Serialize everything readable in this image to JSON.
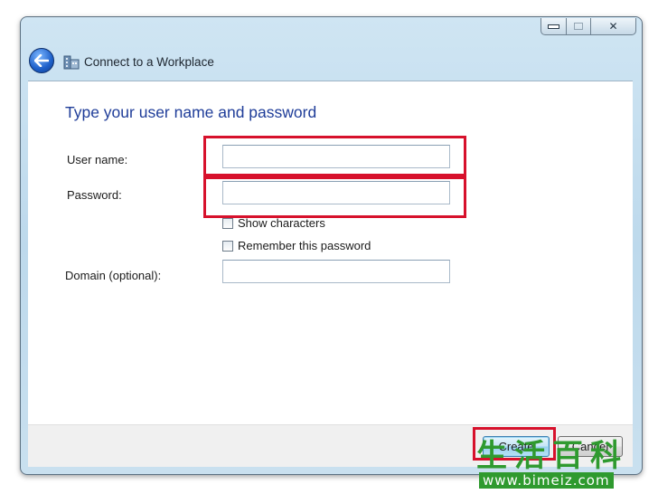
{
  "window": {
    "title": "Connect to a Workplace",
    "caption_buttons": {
      "minimize_icon": "minimize-icon",
      "maximize_icon": "maximize-icon",
      "close_icon": "close-icon",
      "close_glyph": "✕"
    },
    "back_icon": "back-arrow-icon",
    "title_icon": "workplace-network-icon"
  },
  "form": {
    "heading": "Type your user name and password",
    "username": {
      "label": "User name:",
      "value": "",
      "placeholder": ""
    },
    "password": {
      "label": "Password:",
      "value": "",
      "placeholder": ""
    },
    "show_characters": {
      "label": "Show characters",
      "checked": false
    },
    "remember_password": {
      "label": "Remember this password",
      "checked": false
    },
    "domain": {
      "label": "Domain (optional):",
      "value": "",
      "placeholder": ""
    }
  },
  "footer": {
    "create_label": "Create",
    "cancel_label": "Cancel"
  },
  "watermark": {
    "glyphs": [
      "生",
      "活",
      "百",
      "科"
    ],
    "url": "www.bimeiz.com"
  },
  "colors": {
    "highlight": "#d7112c",
    "heading": "#1f3d99",
    "watermark": "#2f9a2f"
  }
}
